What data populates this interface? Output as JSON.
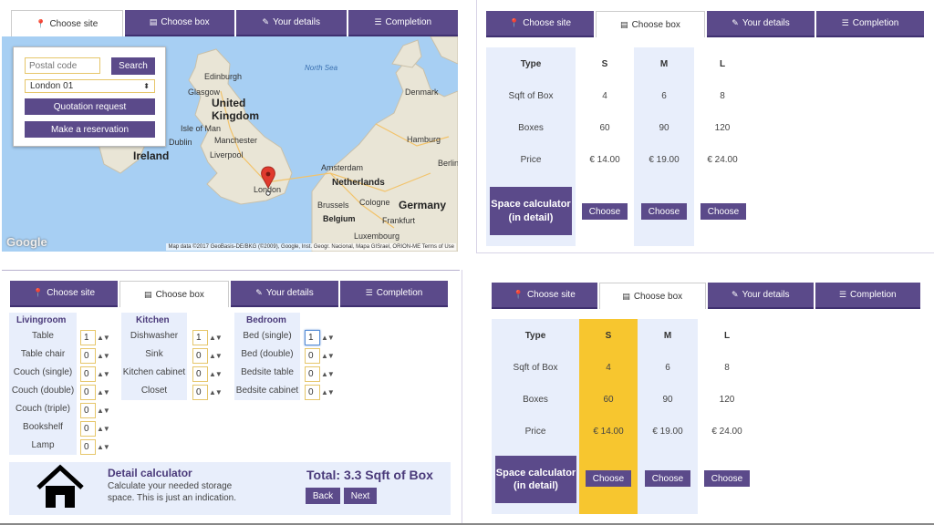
{
  "tabs": {
    "site": "Choose site",
    "box": "Choose box",
    "details": "Your details",
    "completion": "Completion"
  },
  "icons": {
    "site": "map-marker-icon",
    "box": "archive-box-icon",
    "details": "edit-icon",
    "completion": "list-icon"
  },
  "colors": {
    "accent": "#5b4a8a",
    "highlight": "#f7c62f",
    "table_bg": "#e8eefb"
  },
  "map": {
    "postal_placeholder": "Postal code",
    "search_label": "Search",
    "location_value": "London 01",
    "quotation_label": "Quotation request",
    "reservation_label": "Make a reservation",
    "google_logo": "Google",
    "attribution": "Map data ©2017 GeoBasis-DE/BKG (©2009), Google, Inst. Geogr. Nacional, Mapa GISrael, ORION-ME   Terms of Use",
    "labels": {
      "north_sea": "North Sea",
      "uk": "United Kingdom",
      "ireland": "Ireland",
      "isle_of_man": "Isle of Man",
      "dublin": "Dublin",
      "edinburgh": "Edinburgh",
      "glasgow": "Glasgow",
      "manchester": "Manchester",
      "liverpool": "Liverpool",
      "london": "London",
      "amsterdam": "Amsterdam",
      "netherlands": "Netherlands",
      "brussels": "Brussels",
      "belgium": "Belgium",
      "cologne": "Cologne",
      "germany": "Germany",
      "frankfurt": "Frankfurt",
      "luxembourg": "Luxembourg",
      "denmark": "Denmark",
      "hamburg": "Hamburg",
      "berlin": "Berlin"
    }
  },
  "boxes": {
    "header_type": "Type",
    "row_labels": [
      "Sqft of Box",
      "Boxes",
      "Price"
    ],
    "sizes": [
      {
        "name": "S",
        "sqft": "4",
        "boxes": "60",
        "price": "€ 14.00"
      },
      {
        "name": "M",
        "sqft": "6",
        "boxes": "90",
        "price": "€ 19.00"
      },
      {
        "name": "L",
        "sqft": "8",
        "boxes": "120",
        "price": "€ 24.00"
      }
    ],
    "choose_label": "Choose",
    "space_calc_label": "Space calculator (in detail)"
  },
  "calculator": {
    "livingroom": {
      "title": "Livingroom",
      "items": [
        {
          "name": "Table",
          "qty": "1"
        },
        {
          "name": "Table chair",
          "qty": "0"
        },
        {
          "name": "Couch (single)",
          "qty": "0"
        },
        {
          "name": "Couch (double)",
          "qty": "0"
        },
        {
          "name": "Couch (triple)",
          "qty": "0"
        },
        {
          "name": "Bookshelf",
          "qty": "0"
        },
        {
          "name": "Lamp",
          "qty": "0"
        }
      ]
    },
    "kitchen": {
      "title": "Kitchen",
      "items": [
        {
          "name": "Dishwasher",
          "qty": "1"
        },
        {
          "name": "Sink",
          "qty": "0"
        },
        {
          "name": "Kitchen cabinet",
          "qty": "0"
        },
        {
          "name": "Closet",
          "qty": "0"
        }
      ]
    },
    "bedroom": {
      "title": "Bedroom",
      "items": [
        {
          "name": "Bed (single)",
          "qty": "1"
        },
        {
          "name": "Bed (double)",
          "qty": "0"
        },
        {
          "name": "Bedsite table",
          "qty": "0"
        },
        {
          "name": "Bedsite cabinet",
          "qty": "0"
        }
      ]
    },
    "detail_title": "Detail calculator",
    "detail_text": "Calculate your needed storage space. This is just an indication.",
    "total": "Total: 3.3 Sqft of Box",
    "back_label": "Back",
    "next_label": "Next"
  }
}
